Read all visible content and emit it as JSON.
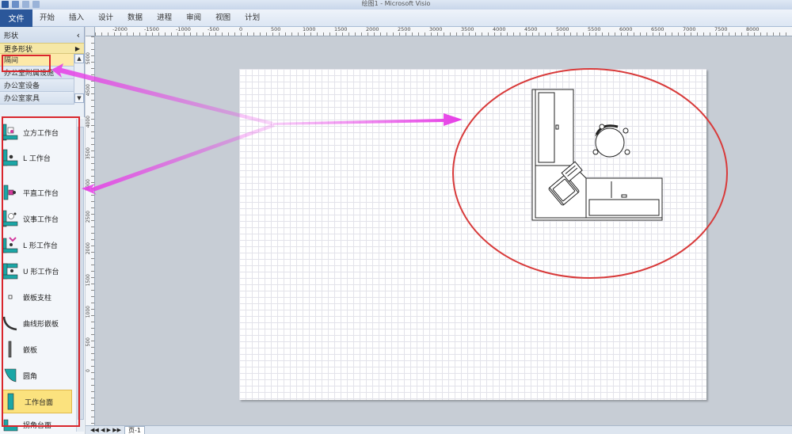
{
  "window": {
    "title": "绘图1 - Microsoft Visio"
  },
  "ribbon": {
    "file_tab": "文件",
    "tabs": [
      "开始",
      "插入",
      "设计",
      "数据",
      "进程",
      "审阅",
      "视图",
      "计划"
    ]
  },
  "shapes_panel": {
    "title": "形状",
    "collapse_glyph": "‹",
    "more_shapes": "更多形状",
    "stencils": [
      {
        "label": "隔间",
        "active": true
      },
      {
        "label": "办公室附属设施",
        "active": false
      },
      {
        "label": "办公室设备",
        "active": false
      },
      {
        "label": "办公室家具",
        "active": false
      }
    ],
    "shapes": [
      {
        "label": "立方工作台",
        "icon": "cube-workstation-icon"
      },
      {
        "label": "L 工作台",
        "icon": "l-workstation-icon"
      },
      {
        "label": "平直工作台",
        "icon": "straight-workstation-icon"
      },
      {
        "label": "议事工作台",
        "icon": "meeting-workstation-icon"
      },
      {
        "label": "L 形工作台",
        "icon": "l-shaped-workstation-icon"
      },
      {
        "label": "U 形工作台",
        "icon": "u-shaped-workstation-icon"
      },
      {
        "label": "嵌板支柱",
        "icon": "panel-post-icon"
      },
      {
        "label": "曲线形嵌板",
        "icon": "curved-panel-icon"
      },
      {
        "label": "嵌板",
        "icon": "panel-icon"
      },
      {
        "label": "圆角",
        "icon": "round-corner-icon"
      },
      {
        "label": "工作台面",
        "icon": "work-surface-icon",
        "selected": true
      },
      {
        "label": "拐角台面",
        "icon": "corner-surface-icon"
      }
    ]
  },
  "ruler": {
    "top_ticks": [
      "-2000",
      "-1500",
      "-1000",
      "-500",
      "0",
      "500",
      "1000",
      "1500",
      "2000",
      "2500",
      "3000",
      "3500",
      "4000",
      "4500",
      "5000",
      "5500",
      "6000",
      "6500",
      "7000",
      "7500",
      "8000"
    ],
    "left_ticks": [
      "5000",
      "4500",
      "4000",
      "3500",
      "3000",
      "2500",
      "2000",
      "1500",
      "1000",
      "500",
      "0"
    ]
  },
  "statusbar": {
    "page_tab": "页-1"
  },
  "colors": {
    "annotation_arrow": "#e63ee6",
    "highlight_box": "#d9262c",
    "focus_ellipse": "#d83a3a",
    "shape_teal": "#1aa6a6"
  }
}
